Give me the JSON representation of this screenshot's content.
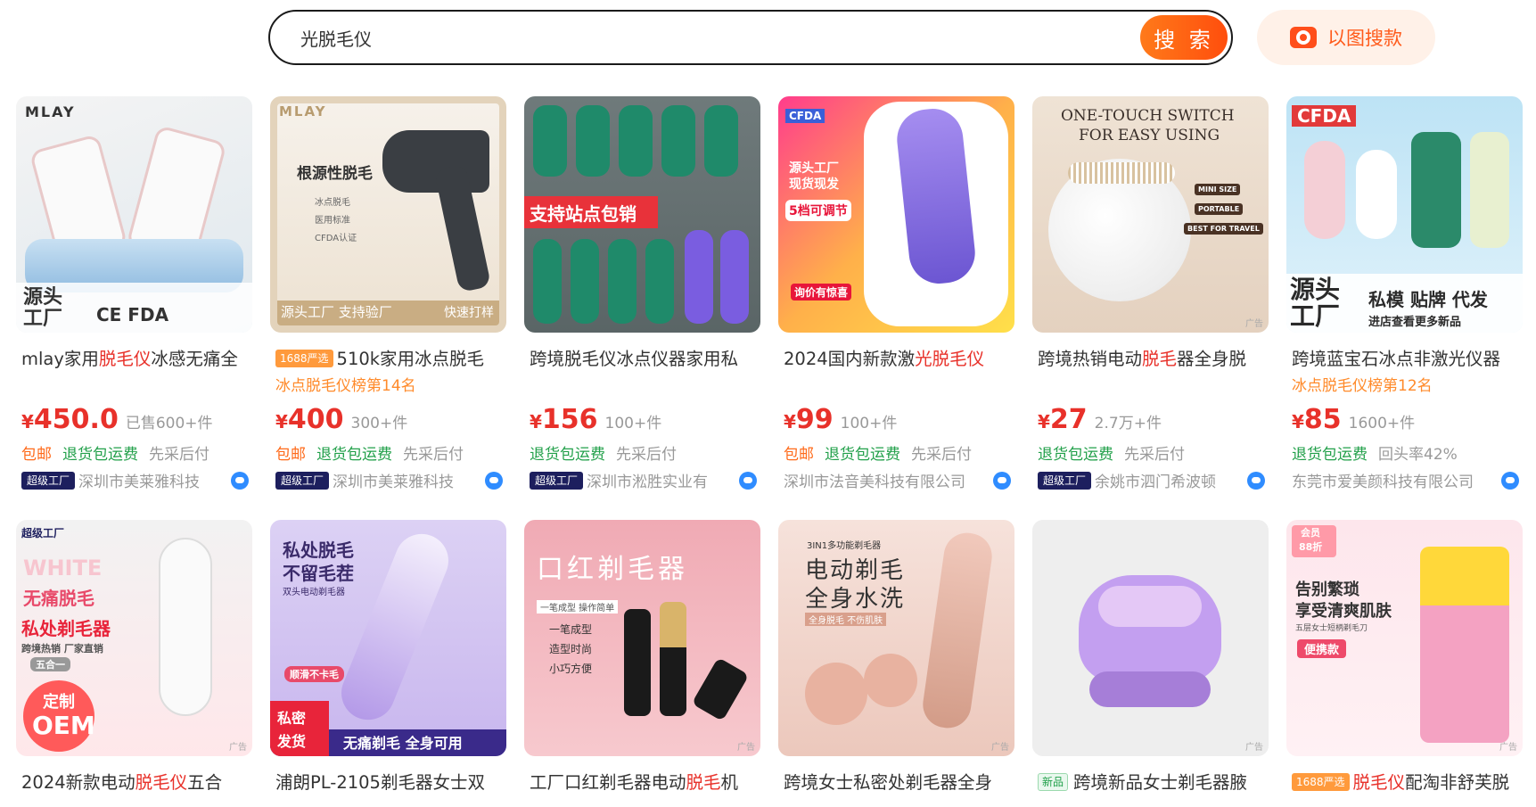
{
  "search": {
    "value": "光脱毛仪",
    "button_label": "搜 索",
    "image_search_label": "以图搜款"
  },
  "colors": {
    "accent": "#ff5a1a",
    "price": "#e8312a",
    "green": "#22a04a"
  },
  "products": [
    {
      "img_texts": [
        "MLAY",
        "源头",
        "工厂",
        "CE FDA"
      ],
      "title_pre": "mlay家用",
      "title_hl": "脱毛仪",
      "title_post": "冰感无痛全",
      "badge": "",
      "rank": "",
      "price": "450.0",
      "sold": "已售600+件",
      "services": [
        "包邮",
        "退货包运费",
        "先采后付"
      ],
      "super": "超级工厂",
      "seller": "深圳市美莱雅科技"
    },
    {
      "img_texts": [
        "MLAY",
        "根源性脱毛",
        "冰点脱毛",
        "医用标准",
        "CFDA认证",
        "源头工厂 支持验厂",
        "快速打样"
      ],
      "title_pre": "510k家用冰点脱毛",
      "title_hl": "",
      "title_post": "",
      "badge": "1688严选",
      "rank": "冰点脱毛仪榜第14名",
      "price": "400",
      "sold": "300+件",
      "services": [
        "包邮",
        "退货包运费",
        "先采后付"
      ],
      "super": "超级工厂",
      "seller": "深圳市美莱雅科技"
    },
    {
      "img_texts": [
        "支持站点包销"
      ],
      "title_pre": "跨境脱毛仪冰点仪器家用私",
      "title_hl": "",
      "title_post": "",
      "badge": "",
      "rank": "",
      "price": "156",
      "sold": "100+件",
      "services": [
        "退货包运费",
        "先采后付"
      ],
      "super": "超级工厂",
      "seller": "深圳市淞胜实业有"
    },
    {
      "img_texts": [
        "CFDA",
        "源头工厂",
        "现货现发",
        "5档可调节",
        "询价有惊喜"
      ],
      "title_pre": "2024国内新款激",
      "title_hl": "光脱毛仪",
      "title_post": "",
      "badge": "",
      "rank": "",
      "price": "99",
      "sold": "100+件",
      "services": [
        "包邮",
        "退货包运费",
        "先采后付"
      ],
      "super": "",
      "seller": "深圳市法音美科技有限公司"
    },
    {
      "img_texts": [
        "ONE-TOUCH SWITCH",
        "FOR EASY USING",
        "MINI SIZE",
        "PORTABLE",
        "BEST FOR TRAVEL"
      ],
      "title_pre": "跨境热销电动",
      "title_hl": "脱毛",
      "title_post": "器全身脱",
      "badge": "",
      "rank": "",
      "price": "27",
      "sold": "2.7万+件",
      "services": [
        "退货包运费",
        "先采后付"
      ],
      "super": "超级工厂",
      "seller": "余姚市泗门希波顿"
    },
    {
      "img_texts": [
        "CFDA",
        "源头",
        "工厂",
        "私模 贴牌 代发",
        "进店查看更多新品"
      ],
      "title_pre": "跨境蓝宝石冰点非激光仪器",
      "title_hl": "",
      "title_post": "",
      "badge": "",
      "rank": "冰点脱毛仪榜第12名",
      "price": "85",
      "sold": "1600+件",
      "services": [
        "退货包运费",
        "回头率42%"
      ],
      "super": "",
      "seller": "东莞市爱美颜科技有限公司"
    }
  ],
  "products_row2": [
    {
      "img_texts": [
        "超级工厂",
        "WHITE",
        "无痛脱毛",
        "私处剃毛器",
        "跨境热销 厂家直销",
        "五合一",
        "定制",
        "OEM"
      ],
      "title_pre": "2024新款电动",
      "title_hl": "脱毛仪",
      "title_post": "五合",
      "badge": ""
    },
    {
      "img_texts": [
        "私处脱毛",
        "不留毛茬",
        "双头电动剃毛器",
        "顺滑不卡毛",
        "私密",
        "发货",
        "无痛剃毛 全身可用"
      ],
      "title_pre": "浦朗PL-2105剃毛器女士双",
      "title_hl": "",
      "title_post": "",
      "badge": ""
    },
    {
      "img_texts": [
        "口红剃毛器",
        "一笔成型 操作简单",
        "一笔成型",
        "造型时尚",
        "小巧方便"
      ],
      "title_pre": "工厂口红剃毛器电动",
      "title_hl": "脱毛",
      "title_post": "机",
      "badge": ""
    },
    {
      "img_texts": [
        "3IN1多功能剃毛器",
        "电动剃毛",
        "全身水洗",
        "全身脱毛 不伤肌肤"
      ],
      "title_pre": "跨境女士私密处剃毛器全身",
      "title_hl": "",
      "title_post": "",
      "badge": ""
    },
    {
      "img_texts": [],
      "title_pre": "跨境新品女士剃毛器腋",
      "title_hl": "",
      "title_post": "",
      "badge": "新品"
    },
    {
      "img_texts": [
        "会员",
        "88折",
        "告别繁琐",
        "享受清爽肌肤",
        "五层女士短柄剃毛刀",
        "便携款"
      ],
      "title_pre": "",
      "title_hl": "脱毛仪",
      "title_post": "配淘非舒芙脱",
      "badge": "1688严选"
    }
  ],
  "ad_label": "广告"
}
